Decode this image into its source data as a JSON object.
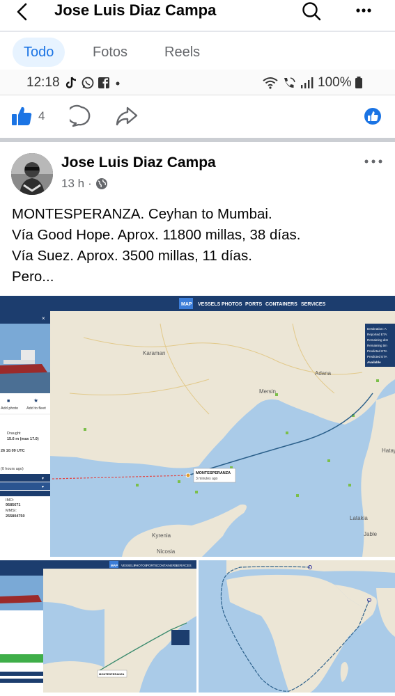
{
  "header": {
    "title": "Jose Luis Diaz Campa",
    "back_icon": "chevron-left-icon",
    "search_icon": "search-icon",
    "more_icon": "more-horizontal-icon"
  },
  "tabs": [
    {
      "label": "Todo",
      "active": true
    },
    {
      "label": "Fotos",
      "active": false
    },
    {
      "label": "Reels",
      "active": false
    }
  ],
  "status_bar": {
    "time": "12:18",
    "battery": "100%",
    "app_icons": [
      "tiktok-icon",
      "whatsapp-icon",
      "facebook-icon",
      "dot-icon"
    ],
    "right_icons": [
      "wifi-icon",
      "call-icon",
      "signal-icon",
      "battery-icon"
    ]
  },
  "actions": {
    "like_count": "4"
  },
  "post": {
    "author": "Jose Luis Diaz Campa",
    "time": "13 h",
    "text_lines": [
      "MONTESPERANZA. Ceyhan to Mumbai.",
      "Vía Good Hope. Aprox. 11800 millas, 38 días.",
      "Vía Suez. Aprox. 3500 millas, 11 días.",
      "Pero..."
    ]
  },
  "map_main": {
    "nav": [
      "MAP",
      "VESSELS",
      "PHOTOS",
      "PORTS",
      "CONTAINERS",
      "SERVICES"
    ],
    "labels": [
      "Karaman",
      "Adana",
      "Mersin",
      "Hatay",
      "Latakia",
      "Jable",
      "Kyrenia",
      "Nicosia"
    ],
    "vessel_label": "MONTESPERANZA",
    "vessel_sub": "3 minutes ago",
    "sidebar": {
      "add_photo": "Add photo",
      "add_fleet": "Add to fleet",
      "draught_label": "Draught",
      "draught_value": "15.6 m (max 17.0)",
      "date": "26 10:09 UTC",
      "ago": "(0 hours ago)",
      "imo_label": "IMO:",
      "imo_value": "9585671",
      "mmsi_label": "MMSI:",
      "mmsi_value": "255804750"
    },
    "info_box": [
      "Destination: A",
      "Reported ETA:",
      "Remaining dist",
      "Remaining tim",
      "Predicted ETA",
      "Predicted ETA",
      "Available"
    ]
  },
  "map_small_left": {
    "nav": [
      "MAP",
      "VESSELS",
      "PHOTOS",
      "PORTS",
      "CONTAINERS",
      "SERVICES"
    ],
    "vessel_label": "MONTESPERANZA"
  },
  "colors": {
    "accent": "#1b74e4",
    "nav_bg": "#1c3d6e",
    "sea": "#aacbe8",
    "land": "#ece6d6"
  }
}
